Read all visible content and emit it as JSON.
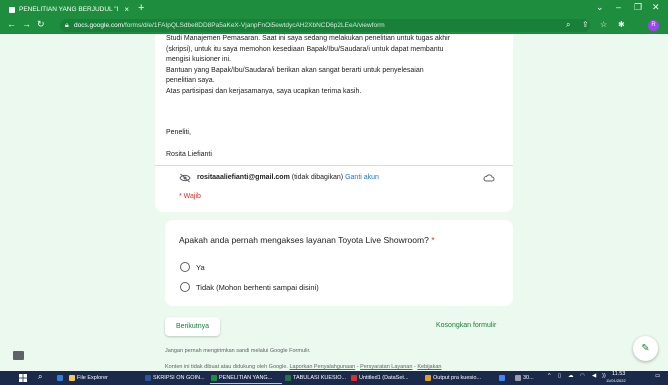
{
  "browser": {
    "tab_title": "PENELITIAN YANG BERJUDUL \"I",
    "tab_close": "×",
    "new_tab": "+",
    "url_domain": "docs.google.com",
    "url_path": "/forms/d/e/1FAIpQLSdbe8DD8Pa5aKeX-VjanpFnOi5ewtdycAH2XbNCD6p2LEeA/viewform"
  },
  "form": {
    "intro_lines": [
      "Studi Manajemen Pemasaran. Saat ini saya sedang melakukan penelitian untuk tugas akhir",
      "(skripsi), untuk itu saya memohon kesediaan Bapak/Ibu/Saudara/i untuk dapat membantu",
      "mengisi kuisioner ini.",
      "Bantuan yang Bapak/Ibu/Saudara/i berikan akan sangat berarti untuk penyelesaian",
      "penelitian saya.",
      "Atas partisipasi dan kerjasamanya, saya ucapkan terima kasih."
    ],
    "signature_title": "Peneliti,",
    "signature_name": "Rosita Liefianti",
    "email": "rositaaaliefianti@gmail.com",
    "email_note": "(tidak dibagikan)",
    "switch_account": "Ganti akun",
    "required_note": "* Wajib",
    "question": "Apakah anda pernah mengakses layanan Toyota Live Showroom?",
    "question_required_mark": "*",
    "options": [
      "Ya",
      "Tidak (Mohon berhenti sampai disini)"
    ],
    "next_button": "Berikutnya",
    "clear_button": "Kosongkan formulir",
    "footer_warning": "Jangan pernah mengirimkan sandi melalui Google Formulir.",
    "footer_text": "Konten ini tidak dibuat atau didukung oleh Google.",
    "footer_link1": "Laporkan Penyalahgunaan",
    "footer_sep1": " - ",
    "footer_link2": "Persyaratan Layanan",
    "footer_sep2": " - ",
    "footer_link3": "Kebijakan"
  },
  "taskbar": {
    "items": [
      "File Explorer",
      "SKRIPSI ON GOIN...",
      "PENELITIAN YANG...",
      "TABULASI KUESIO...",
      "Untitled1 (DataSet...",
      "Output pra kuesio..."
    ],
    "tray_temp": "30...",
    "time": "11.53",
    "date": "11/01/2022"
  },
  "colors": {
    "theme": "#1e8e3e",
    "accent": "#188038",
    "required": "#d93025",
    "link": "#1a73e8"
  }
}
